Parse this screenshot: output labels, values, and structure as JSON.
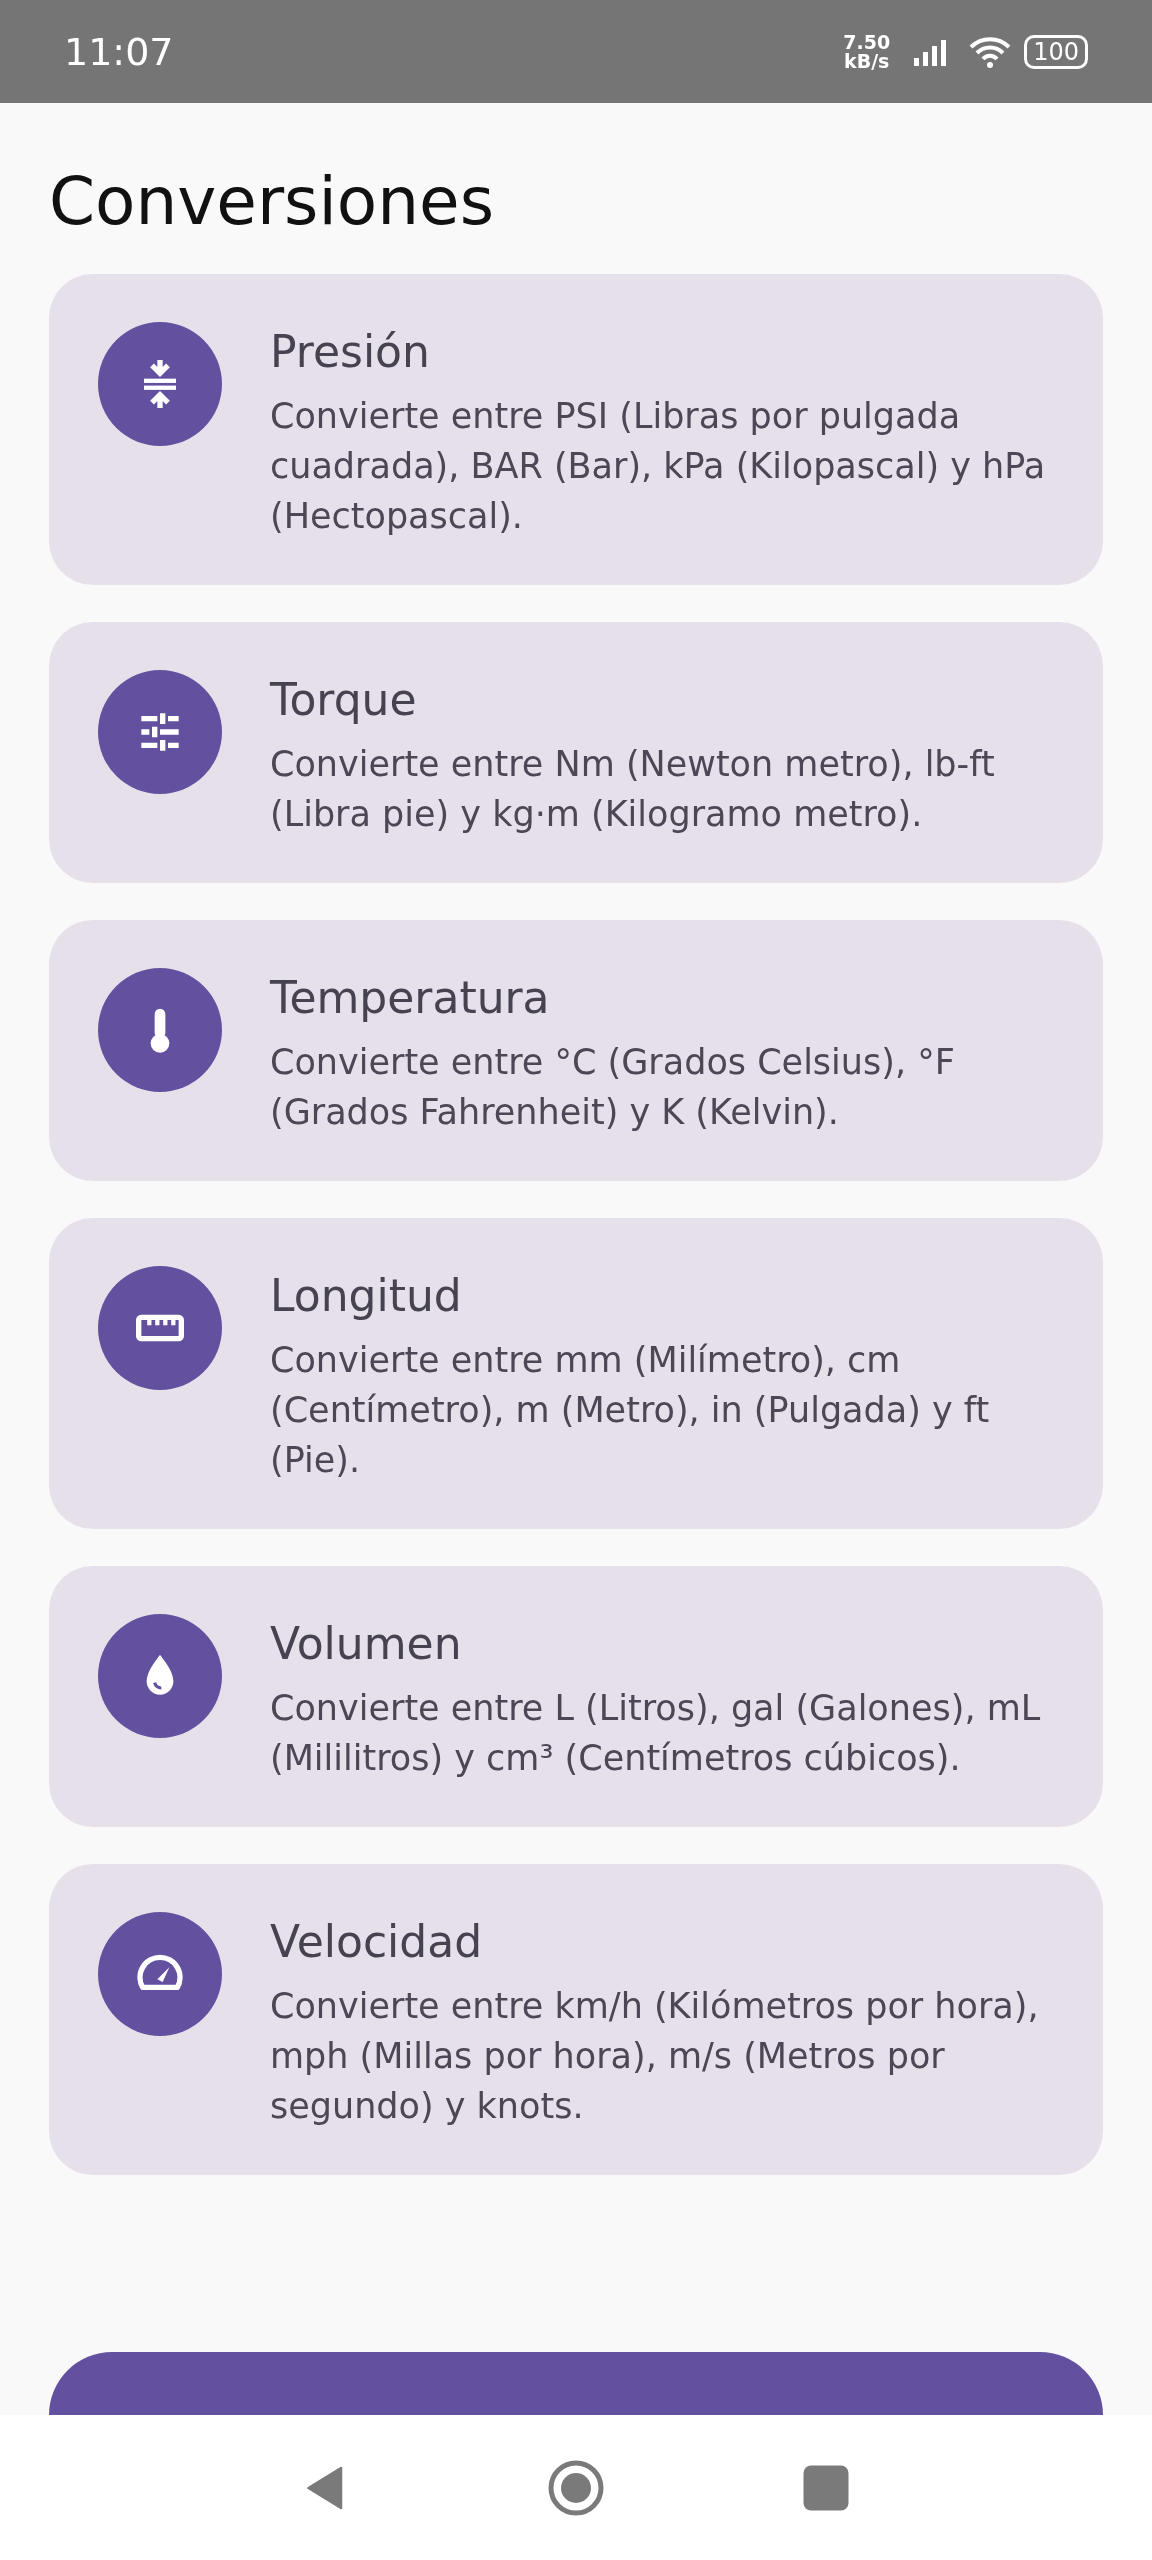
{
  "status_bar": {
    "time": "11:07",
    "speed_value": "7.50",
    "speed_unit": "kB/s",
    "battery": "100"
  },
  "title": "Conversiones",
  "cards": [
    {
      "kind": "pressure",
      "title": "Presión",
      "description": "Convierte entre PSI (Libras por pulgada cuadrada), BAR (Bar), kPa (Kilopascal) y hPa (Hectopascal)."
    },
    {
      "kind": "torque",
      "title": "Torque",
      "description": "Convierte entre Nm (Newton metro), lb-ft (Libra pie) y kg·m (Kilogramo metro)."
    },
    {
      "kind": "temperature",
      "title": "Temperatura",
      "description": "Convierte entre °C (Grados Celsius), °F (Grados Fahrenheit) y K (Kelvin)."
    },
    {
      "kind": "length",
      "title": "Longitud",
      "description": "Convierte entre mm (Milímetro), cm (Centímetro), m (Metro), in (Pulgada) y ft (Pie)."
    },
    {
      "kind": "volume",
      "title": "Volumen",
      "description": "Convierte entre L (Litros), gal (Galones), mL (Mililitros) y cm³ (Centímetros cúbicos)."
    },
    {
      "kind": "speed",
      "title": "Velocidad",
      "description": "Convierte entre km/h (Kilómetros por hora), mph (Millas por hora), m/s (Metros por segundo) y knots."
    }
  ]
}
